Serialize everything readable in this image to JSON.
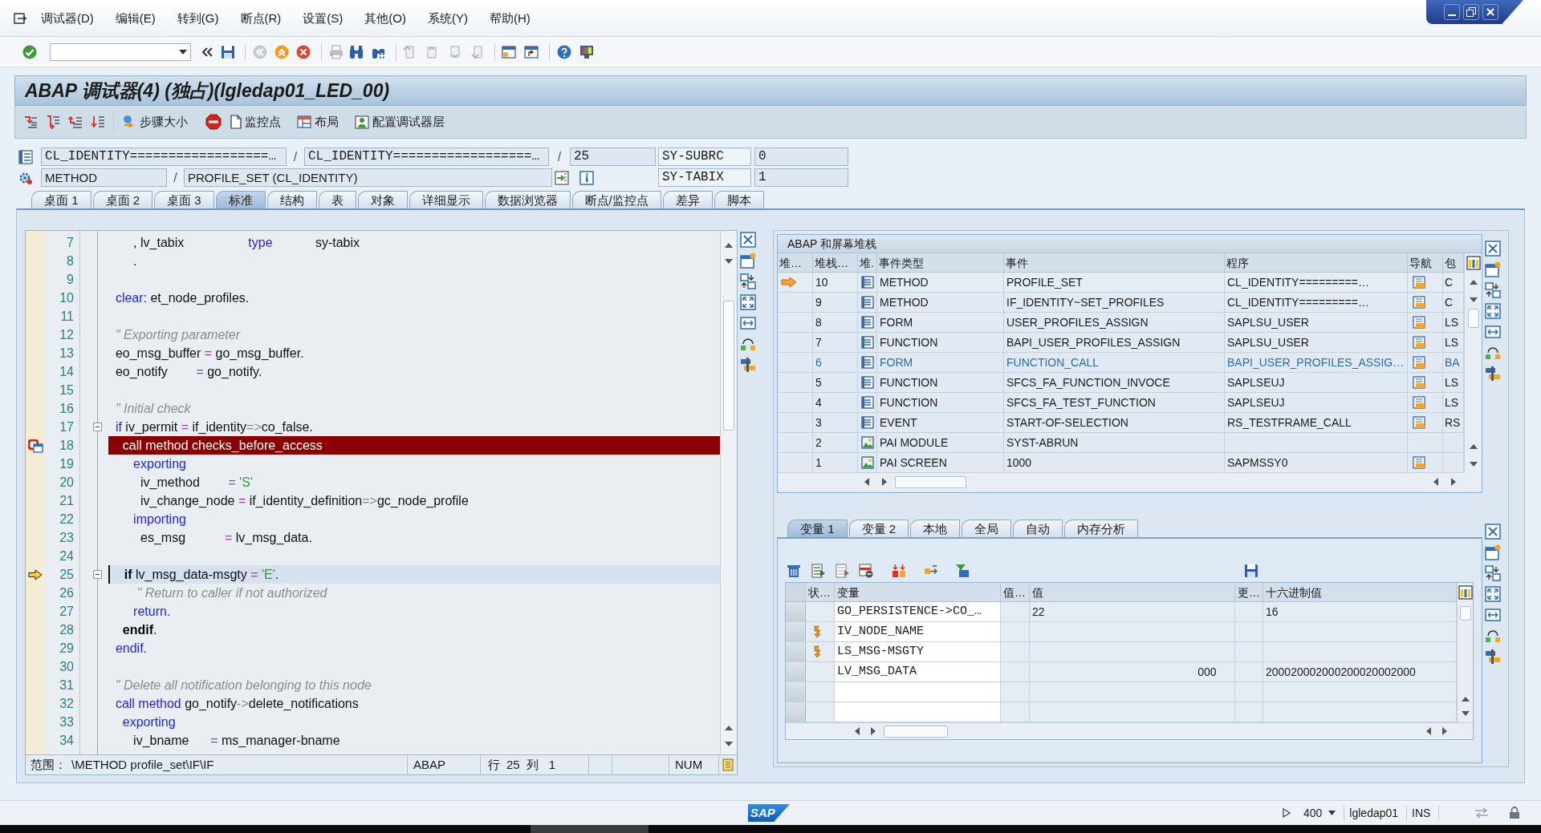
{
  "menu_bar": {
    "items": [
      "调试器(D)",
      "编辑(E)",
      "转到(G)",
      "断点(R)",
      "设置(S)",
      "其他(O)",
      "系统(Y)",
      "帮助(H)"
    ]
  },
  "title": "ABAP 调试器(4) (独占)(lgledap01_LED_00)",
  "app_toolbar": {
    "buttons": [
      "步骤大小",
      "监控点",
      "布局",
      "配置调试器层"
    ]
  },
  "source_info": {
    "program": "CL_IDENTITY==================…",
    "separator_1": "/",
    "include": "CL_IDENTITY==================…",
    "separator_2": "/",
    "line": "25",
    "block_type": "METHOD",
    "separator_3": "/",
    "block_name": "PROFILE_SET (CL_IDENTITY)"
  },
  "system_fields": [
    {
      "name": "SY-SUBRC",
      "value": "0"
    },
    {
      "name": "SY-TABIX",
      "value": "1"
    }
  ],
  "desktop_tabs": [
    {
      "label": "桌面 1",
      "selected": false
    },
    {
      "label": "桌面 2",
      "selected": false
    },
    {
      "label": "桌面 3",
      "selected": false
    },
    {
      "label": "标准",
      "selected": true
    },
    {
      "label": "结构",
      "selected": false
    },
    {
      "label": "表",
      "selected": false
    },
    {
      "label": "对象",
      "selected": false
    },
    {
      "label": "详细显示",
      "selected": false
    },
    {
      "label": "数据浏览器",
      "selected": false
    },
    {
      "label": "断点/监控点",
      "selected": false
    },
    {
      "label": "差异",
      "selected": false
    },
    {
      "label": "脚本",
      "selected": false
    }
  ],
  "editor": {
    "lines": [
      {
        "number": "7",
        "breakpoint": false,
        "current": false,
        "fold": false,
        "tokens": [
          {
            "kind": "id",
            "text": "       , lv_tabix                  "
          },
          {
            "kind": "kw",
            "text": "type"
          },
          {
            "kind": "id",
            "text": "            sy-tabix"
          }
        ]
      },
      {
        "number": "8",
        "breakpoint": false,
        "current": false,
        "fold": false,
        "tokens": [
          {
            "kind": "id",
            "text": "       ."
          }
        ]
      },
      {
        "number": "9",
        "breakpoint": false,
        "current": false,
        "fold": false
      },
      {
        "number": "10",
        "breakpoint": false,
        "current": false,
        "fold": false,
        "tokens": [
          {
            "kind": "kw",
            "text": "  clear:"
          },
          {
            "kind": "id",
            "text": " et_node_profiles."
          }
        ]
      },
      {
        "number": "11",
        "breakpoint": false,
        "current": false,
        "fold": false
      },
      {
        "number": "12",
        "breakpoint": false,
        "current": false,
        "fold": false,
        "tokens": [
          {
            "kind": "cmt",
            "text": "  \" Exporting parameter"
          }
        ]
      },
      {
        "number": "13",
        "breakpoint": false,
        "current": false,
        "fold": false,
        "tokens": [
          {
            "kind": "id",
            "text": "  eo_msg_buffer "
          },
          {
            "kind": "op",
            "text": "="
          },
          {
            "kind": "id",
            "text": " go_msg_buffer."
          }
        ]
      },
      {
        "number": "14",
        "breakpoint": false,
        "current": false,
        "fold": false,
        "tokens": [
          {
            "kind": "id",
            "text": "  eo_notify        "
          },
          {
            "kind": "op",
            "text": "="
          },
          {
            "kind": "id",
            "text": " go_notify."
          }
        ]
      },
      {
        "number": "15",
        "breakpoint": false,
        "current": false,
        "fold": false
      },
      {
        "number": "16",
        "breakpoint": false,
        "current": false,
        "fold": false,
        "tokens": [
          {
            "kind": "cmt",
            "text": "  \" Initial check"
          }
        ]
      },
      {
        "number": "17",
        "breakpoint": false,
        "current": false,
        "fold": true,
        "tokens": [
          {
            "kind": "kw",
            "text": "  if"
          },
          {
            "kind": "id",
            "text": " iv_permit "
          },
          {
            "kind": "op",
            "text": "="
          },
          {
            "kind": "id",
            "text": " if_identity"
          },
          {
            "kind": "sym",
            "text": "=>"
          },
          {
            "kind": "id",
            "text": "co_false."
          }
        ]
      },
      {
        "number": "18",
        "breakpoint": true,
        "current": false,
        "fold": false,
        "tokens": [
          {
            "kind": "kw",
            "text": "    call method"
          },
          {
            "kind": "id",
            "text": " checks_before_access"
          }
        ]
      },
      {
        "number": "19",
        "breakpoint": false,
        "current": false,
        "fold": false,
        "tokens": [
          {
            "kind": "kw",
            "text": "       exporting"
          }
        ]
      },
      {
        "number": "20",
        "breakpoint": false,
        "current": false,
        "fold": false,
        "tokens": [
          {
            "kind": "id",
            "text": "         iv_method        "
          },
          {
            "kind": "op",
            "text": "="
          },
          {
            "kind": "str",
            "text": " 'S'"
          }
        ]
      },
      {
        "number": "21",
        "breakpoint": false,
        "current": false,
        "fold": false,
        "tokens": [
          {
            "kind": "id",
            "text": "         iv_change_node "
          },
          {
            "kind": "op",
            "text": "="
          },
          {
            "kind": "id",
            "text": " if_identity_definition"
          },
          {
            "kind": "sym",
            "text": "=>"
          },
          {
            "kind": "id",
            "text": "gc_node_profile"
          }
        ]
      },
      {
        "number": "22",
        "breakpoint": false,
        "current": false,
        "fold": false,
        "tokens": [
          {
            "kind": "kw",
            "text": "       importing"
          }
        ]
      },
      {
        "number": "23",
        "breakpoint": false,
        "current": false,
        "fold": false,
        "tokens": [
          {
            "kind": "id",
            "text": "         es_msg           "
          },
          {
            "kind": "op",
            "text": "="
          },
          {
            "kind": "id",
            "text": " lv_msg_data."
          }
        ]
      },
      {
        "number": "24",
        "breakpoint": false,
        "current": false,
        "fold": false
      },
      {
        "number": "25",
        "breakpoint": false,
        "current": true,
        "fold": true,
        "tokens": [
          {
            "kind": "bold",
            "text": "    if"
          },
          {
            "kind": "id",
            "text": " lv_msg_data-msgty "
          },
          {
            "kind": "op",
            "text": "="
          },
          {
            "kind": "str",
            "text": " 'E'"
          },
          {
            "kind": "id",
            "text": "."
          }
        ]
      },
      {
        "number": "26",
        "breakpoint": false,
        "current": false,
        "fold": false,
        "tokens": [
          {
            "kind": "cmt",
            "text": "        \" Return to caller if not authorized"
          }
        ]
      },
      {
        "number": "27",
        "breakpoint": false,
        "current": false,
        "fold": false,
        "tokens": [
          {
            "kind": "kw",
            "text": "       return."
          }
        ]
      },
      {
        "number": "28",
        "breakpoint": false,
        "current": false,
        "fold": false,
        "tokens": [
          {
            "kind": "bold",
            "text": "    endif"
          },
          {
            "kind": "id",
            "text": "."
          }
        ]
      },
      {
        "number": "29",
        "breakpoint": false,
        "current": false,
        "fold": false,
        "tokens": [
          {
            "kind": "kw",
            "text": "  endif."
          }
        ]
      },
      {
        "number": "30",
        "breakpoint": false,
        "current": false,
        "fold": false
      },
      {
        "number": "31",
        "breakpoint": false,
        "current": false,
        "fold": false,
        "tokens": [
          {
            "kind": "cmt",
            "text": "  \" Delete all notification belonging to this node"
          }
        ]
      },
      {
        "number": "32",
        "breakpoint": false,
        "current": false,
        "fold": false,
        "tokens": [
          {
            "kind": "kw",
            "text": "  call method"
          },
          {
            "kind": "id",
            "text": " go_notify"
          },
          {
            "kind": "sym",
            "text": "->"
          },
          {
            "kind": "id",
            "text": "delete_notifications"
          }
        ]
      },
      {
        "number": "33",
        "breakpoint": false,
        "current": false,
        "fold": false,
        "tokens": [
          {
            "kind": "kw",
            "text": "    exporting"
          }
        ]
      },
      {
        "number": "34",
        "breakpoint": false,
        "current": false,
        "fold": false,
        "tokens": [
          {
            "kind": "id",
            "text": "       iv_bname      "
          },
          {
            "kind": "op",
            "text": "="
          },
          {
            "kind": "id",
            "text": " ms_manager-bname"
          }
        ]
      }
    ],
    "status": {
      "scope_label": "范围：",
      "scope": "\\METHOD profile_set\\IF\\IF",
      "language": "ABAP",
      "row_label": "行",
      "row": "25",
      "column_label": "列",
      "column": "1",
      "mode": "NUM"
    }
  },
  "stack": {
    "title": "ABAP 和屏幕堆栈",
    "columns": [
      "堆…",
      "堆栈…",
      "堆.",
      "事件类型",
      "事件",
      "程序",
      "导航",
      "包"
    ],
    "rows": [
      {
        "current": true,
        "selected": false,
        "number": "10",
        "kind": "source",
        "event_type": "METHOD",
        "event": "PROFILE_SET",
        "program": "CL_IDENTITY=========…",
        "navigation": true,
        "column_8": "C"
      },
      {
        "current": false,
        "selected": false,
        "number": "9",
        "kind": "source",
        "event_type": "METHOD",
        "event": "IF_IDENTITY~SET_PROFILES",
        "program": "CL_IDENTITY=========…",
        "navigation": true,
        "column_8": "C"
      },
      {
        "current": false,
        "selected": false,
        "number": "8",
        "kind": "source",
        "event_type": "FORM",
        "event": "USER_PROFILES_ASSIGN",
        "program": "SAPLSU_USER",
        "navigation": true,
        "column_8": "LS"
      },
      {
        "current": false,
        "selected": false,
        "number": "7",
        "kind": "source",
        "event_type": "FUNCTION",
        "event": "BAPI_USER_PROFILES_ASSIGN",
        "program": "SAPLSU_USER",
        "navigation": true,
        "column_8": "LS"
      },
      {
        "current": false,
        "selected": true,
        "number": "6",
        "kind": "source",
        "event_type": "FORM",
        "event": "FUNCTION_CALL",
        "program": "BAPI_USER_PROFILES_ASSIG…",
        "navigation": true,
        "column_8": "BA"
      },
      {
        "current": false,
        "selected": false,
        "number": "5",
        "kind": "source",
        "event_type": "FUNCTION",
        "event": "SFCS_FA_FUNCTION_INVOCE",
        "program": "SAPLSEUJ",
        "navigation": true,
        "column_8": "LS"
      },
      {
        "current": false,
        "selected": false,
        "number": "4",
        "kind": "source",
        "event_type": "FUNCTION",
        "event": "SFCS_FA_TEST_FUNCTION",
        "program": "SAPLSEUJ",
        "navigation": true,
        "column_8": "LS"
      },
      {
        "current": false,
        "selected": false,
        "number": "3",
        "kind": "source",
        "event_type": "EVENT",
        "event": "START-OF-SELECTION",
        "program": "RS_TESTFRAME_CALL",
        "navigation": true,
        "column_8": "RS"
      },
      {
        "current": false,
        "selected": false,
        "number": "2",
        "kind": "screen",
        "event_type": "PAI MODULE",
        "event": "SYST-ABRUN",
        "navigation": false
      },
      {
        "current": false,
        "selected": false,
        "number": "1",
        "kind": "screen",
        "event_type": "PAI SCREEN",
        "event": "1000",
        "program": "SAPMSSY0",
        "navigation": true
      }
    ]
  },
  "variables": {
    "tabs": [
      {
        "label": "变量 1",
        "selected": true
      },
      {
        "label": "变量 2",
        "selected": false
      },
      {
        "label": "本地",
        "selected": false
      },
      {
        "label": "全局",
        "selected": false
      },
      {
        "label": "自动",
        "selected": false
      },
      {
        "label": "内存分析",
        "selected": false
      }
    ],
    "columns": [
      "状…",
      "变量",
      "值…",
      "值",
      "更…",
      "十六进制值"
    ],
    "rows": [
      {
        "flagged": false,
        "name": "GO_PERSISTENCE->CO_…",
        "value": "22",
        "hex": "16"
      },
      {
        "flagged": true,
        "name": "IV_NODE_NAME"
      },
      {
        "flagged": true,
        "name": "LS_MSG-MSGTY"
      },
      {
        "flagged": false,
        "name": "LV_MSG_DATA",
        "value": "                                                     000",
        "hex": "200020002000200020002000"
      },
      {
        "flagged": false
      },
      {
        "flagged": false
      }
    ]
  },
  "status_bar": {
    "logo": "SAP",
    "client": "400",
    "server": "lgledap01",
    "mode": "INS"
  }
}
